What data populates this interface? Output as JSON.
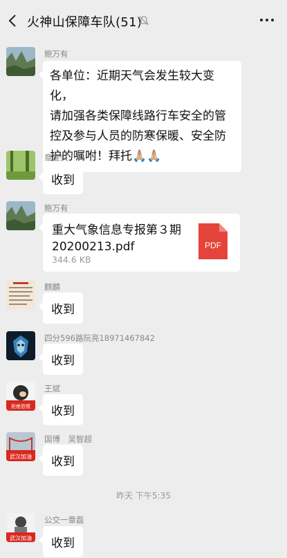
{
  "header": {
    "title": "火神山保障车队(51)"
  },
  "messages": [
    {
      "sender": "鲍万有",
      "lines": [
        "各单位：近期天气会发生较大变化，",
        "请加强各类保障线路行车安全的管",
        "控及参与人员的防寒保暖、安全防",
        "护的嘱咐！拜托🙏🏼🙏🏼"
      ]
    },
    {
      "sender": "章建兴",
      "text": "收到"
    },
    {
      "sender": "鲍万有",
      "file": {
        "name_line1": "重大气象信息专报第３期",
        "name_line2": "20200213.pdf",
        "size": "344.6 KB",
        "icon_label": "PDF"
      }
    },
    {
      "sender": "麒麟",
      "text": "收到"
    },
    {
      "sender": "四分596路阮亮18971467842",
      "text": "收到"
    },
    {
      "sender": "王斌",
      "text": "收到",
      "avatar_text": "拒绝恐慌"
    },
    {
      "sender": "国博　吴智超",
      "text": "收到",
      "avatar_text": "武汉加油"
    },
    {
      "sender": "公交一章磊",
      "text": "收到",
      "avatar_text": "武汉加油"
    }
  ],
  "timestamp": "昨天 下午5:35",
  "colors": {
    "background": "#ededed",
    "bubble": "#ffffff",
    "pdf": "#e5443a"
  }
}
